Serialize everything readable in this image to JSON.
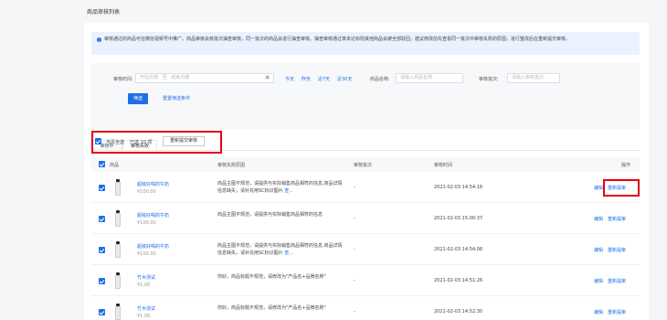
{
  "page_title": "商品审核列表",
  "notice": "审核通过的商品可在微信视频号中推广。商品审核会核批次抽查审核，同一批次的商品会进行抽查审核。抽查审核通过率未达标则其他商品会被全部驳回，建议修改前先查看同一批次中审核失败的原因，进行整改后在重新提交审核。",
  "filter": {
    "time_label": "审核时间:",
    "start_placeholder": "开始日期",
    "separator": "至",
    "end_placeholder": "结束日期",
    "quick_ranges": [
      "今天",
      "昨天",
      "近7天",
      "近30天"
    ],
    "name_label": "商品名称:",
    "name_placeholder": "请输入商品名称",
    "batch_label": "审核批次:",
    "batch_placeholder": "请输入审核批次",
    "search_button": "筛选",
    "reset_link": "重置筛选条件"
  },
  "tabs": [
    {
      "label": "审核中",
      "active": false
    },
    {
      "label": "审核失败",
      "active": true
    }
  ],
  "bulk": {
    "select_page": "当页全选",
    "selected": "已选 10 项",
    "resubmit": "重新提交审核"
  },
  "table": {
    "headers": [
      "商品",
      "审核失败原因",
      "审核批次",
      "审核时间",
      "操作"
    ],
    "rows": [
      {
        "name": "超级好喝的牛奶",
        "price": "¥100.00",
        "reason": "商品主图不规范，请提供与实际销售商品相符的信息,商品详情信息缺失，请补充用SC标识图片",
        "more": "查...",
        "batch": "-",
        "time": "2021-02-03 14:54:18"
      },
      {
        "name": "超级好喝的牛奶",
        "price": "¥100.00",
        "reason": "商品主图不规范，请提供与实际销售商品相符的信息",
        "more": "",
        "batch": "-",
        "time": "2021-02-03 15:00:37"
      },
      {
        "name": "超级好喝的牛奶",
        "price": "¥100.00",
        "reason": "商品主图不规范，请提供与实际销售商品相符的信息,商品详情信息缺失，请补充用SC标识图片",
        "more": "查...",
        "batch": "-",
        "time": "2021-02-03 14:54:08"
      },
      {
        "name": "竹木测试",
        "price": "¥1.00",
        "reason": "你好，商品标题不规范，请修改为\"产品名+品牌名称\"",
        "more": "",
        "batch": "-",
        "time": "2021-02-03 14:51:26"
      },
      {
        "name": "竹木测试",
        "price": "¥1.00",
        "reason": "你好，商品标题不规范，请修改为\"产品名+品牌名称\"",
        "more": "",
        "batch": "-",
        "time": "2021-02-03 14:52:30"
      }
    ],
    "op_edit": "编辑",
    "op_resubmit": "重新提审"
  },
  "colors": {
    "accent": "#1e6fe8",
    "highlight": "#e60012"
  }
}
